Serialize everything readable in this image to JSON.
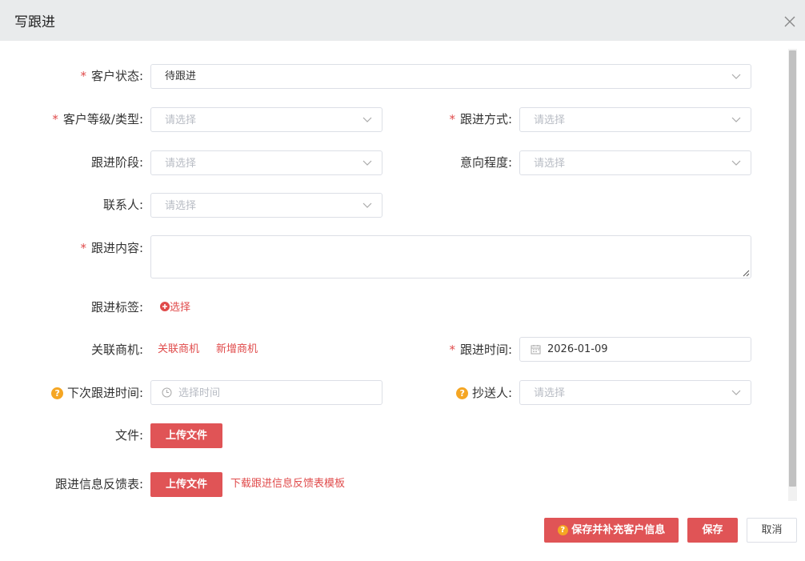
{
  "dialog": {
    "title": "写跟进"
  },
  "form": {
    "customer_status": {
      "label": "客户状态:",
      "value": "待跟进"
    },
    "customer_level": {
      "label": "客户等级/类型:",
      "placeholder": "请选择"
    },
    "follow_method": {
      "label": "跟进方式:",
      "placeholder": "请选择"
    },
    "follow_stage": {
      "label": "跟进阶段:",
      "placeholder": "请选择"
    },
    "intent_level": {
      "label": "意向程度:",
      "placeholder": "请选择"
    },
    "contact": {
      "label": "联系人:",
      "placeholder": "请选择"
    },
    "follow_content": {
      "label": "跟进内容:",
      "value": ""
    },
    "follow_tags": {
      "label": "跟进标签:",
      "select_label": "选择"
    },
    "related_opportunity": {
      "label": "关联商机:",
      "link_related": "关联商机",
      "link_new": "新增商机"
    },
    "follow_time": {
      "label": "跟进时间:",
      "value": "2026-01-09"
    },
    "next_follow_time": {
      "label": "下次跟进时间:",
      "placeholder": "选择时间"
    },
    "cc": {
      "label": "抄送人:",
      "placeholder": "请选择"
    },
    "file": {
      "label": "文件:",
      "button": "上传文件"
    },
    "feedback_form": {
      "label": "跟进信息反馈表:",
      "button": "上传文件",
      "download_link": "下载跟进信息反馈表模板"
    }
  },
  "footer": {
    "save_and_complete": "保存并补充客户信息",
    "save": "保存",
    "cancel": "取消"
  },
  "colors": {
    "accent": "#e05456",
    "required": "#e04b4b",
    "help": "#f5a623"
  },
  "icons": {
    "close": "close-icon",
    "chevron": "chevron-down-icon",
    "calendar": "calendar-icon",
    "clock": "clock-icon",
    "plus": "plus-circle-icon",
    "help": "question-circle-icon"
  }
}
